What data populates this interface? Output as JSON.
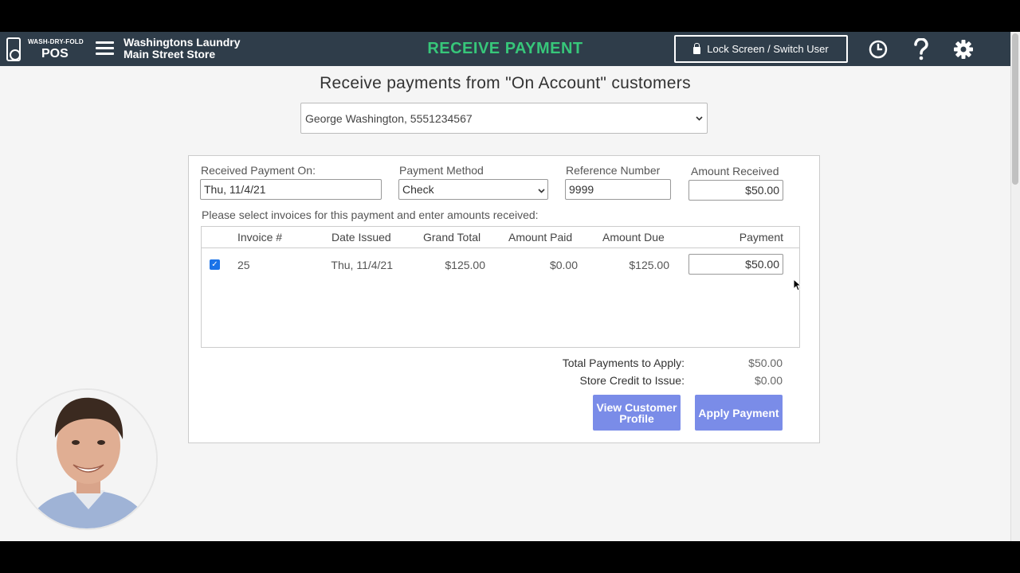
{
  "header": {
    "brand_small": "WASH-DRY-FOLD",
    "brand_big": "POS",
    "store_line1": "Washingtons Laundry",
    "store_line2": "Main Street Store",
    "title": "RECEIVE PAYMENT",
    "lock_label": "Lock Screen / Switch User",
    "icons": [
      "menu-icon",
      "clock-icon",
      "help-icon",
      "gear-icon"
    ]
  },
  "main": {
    "heading": "Receive payments from \"On Account\" customers",
    "customer_selected": "George Washington, 5551234567"
  },
  "form": {
    "received_on_label": "Received Payment On:",
    "received_on_value": "Thu, 11/4/21",
    "method_label": "Payment Method",
    "method_value": "Check",
    "reference_label": "Reference Number",
    "reference_value": "9999",
    "amount_label": "Amount Received",
    "amount_value": "$50.00",
    "instructions": "Please select invoices for this payment and enter amounts received:"
  },
  "table": {
    "headers": [
      "Invoice #",
      "Date Issued",
      "Grand Total",
      "Amount Paid",
      "Amount Due",
      "Payment"
    ],
    "rows": [
      {
        "checked": true,
        "invoice": "25",
        "date": "Thu, 11/4/21",
        "grand_total": "$125.00",
        "amount_paid": "$0.00",
        "amount_due": "$125.00",
        "payment": "$50.00"
      }
    ]
  },
  "summary": {
    "total_label": "Total Payments to Apply:",
    "total_value": "$50.00",
    "credit_label": "Store Credit to Issue:",
    "credit_value": "$0.00"
  },
  "buttons": {
    "view_profile": "View Customer Profile",
    "apply": "Apply Payment"
  },
  "colors": {
    "topbar": "#2f3d4a",
    "title_green": "#37c77a",
    "button": "#7a8ce8"
  }
}
